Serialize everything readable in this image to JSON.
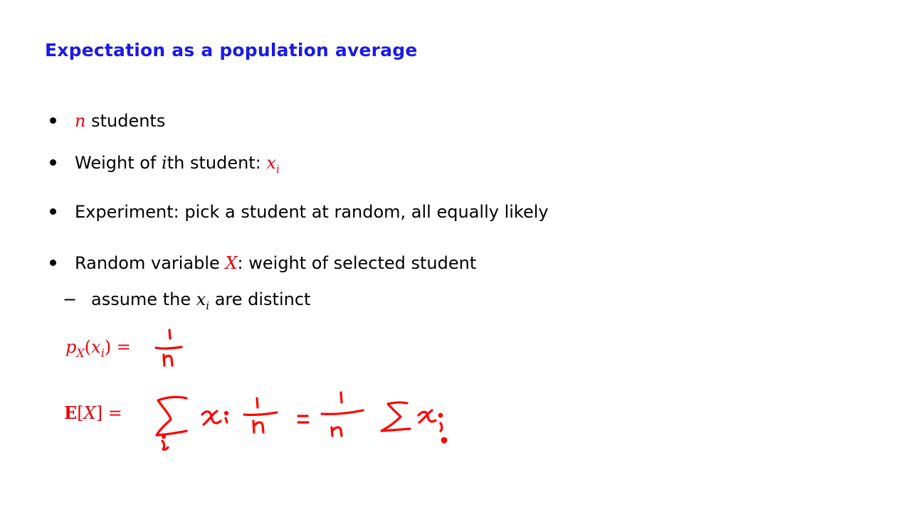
{
  "title": "Expectation as a population average",
  "bullets": {
    "b1": {
      "var": "n",
      "text": " students"
    },
    "b2": {
      "pre": "Weight of ",
      "i": "i",
      "mid": "th student: ",
      "x": "x",
      "sub": "i"
    },
    "b3": {
      "text": "Experiment: pick a student at random, all equally likely"
    },
    "b4": {
      "pre": "Random variable ",
      "X": "X",
      "post": ": weight of selected student"
    },
    "sub1": {
      "dash": "−",
      "pre": "assume the ",
      "x": "x",
      "sub": "i",
      "post": " are distinct"
    }
  },
  "formulas": {
    "pmf": {
      "p": "p",
      "psub": "X",
      "open": "(",
      "x": "x",
      "xsub": "i",
      "close": ") ="
    },
    "expectation": {
      "E": "E",
      "bracket_open": "[",
      "X": "X",
      "bracket_close": "] ="
    }
  },
  "colors": {
    "title": "#1a1ae6",
    "accent": "#e8000b",
    "ink": "#ff0000"
  }
}
